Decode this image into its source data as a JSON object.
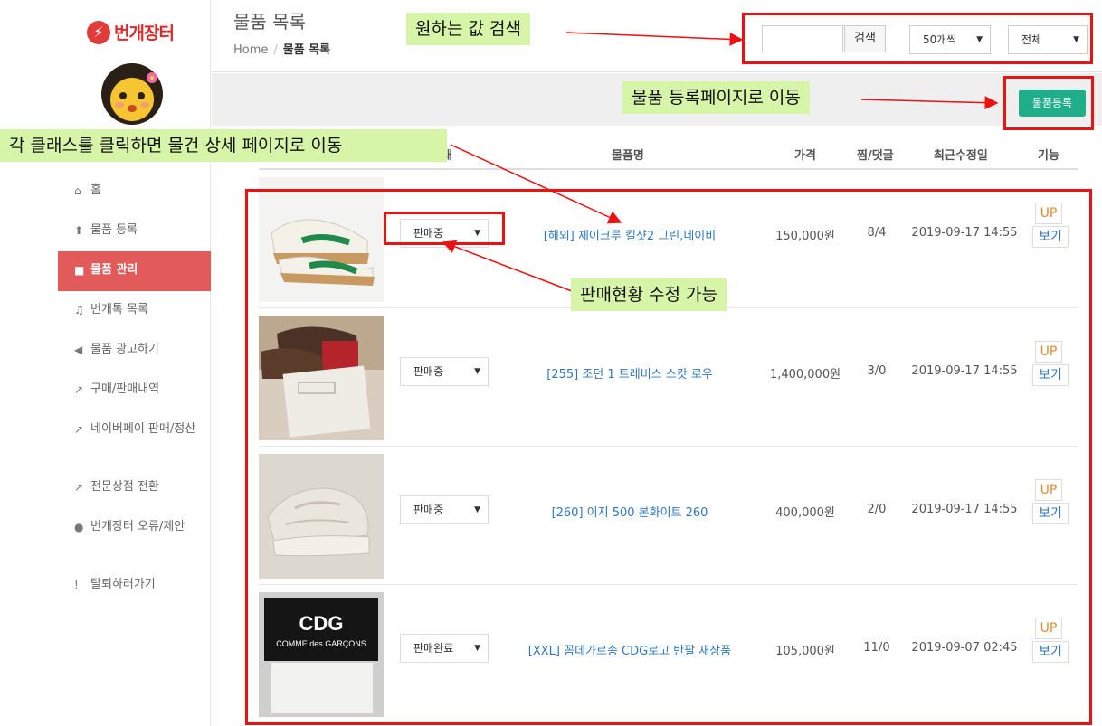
{
  "sidebar": {
    "logo_text": "번개장터",
    "logo_mark": "⚡",
    "items": [
      {
        "icon": "home-icon",
        "glyph": "⌂",
        "label": "홈"
      },
      {
        "icon": "upload-icon",
        "glyph": "⬆",
        "label": "물품 등록"
      },
      {
        "icon": "cube-icon",
        "glyph": "■",
        "label": "물품 관리"
      },
      {
        "icon": "bell-icon",
        "glyph": "♫",
        "label": "번개톡 목록"
      },
      {
        "icon": "megaphone-icon",
        "glyph": "◀",
        "label": "물품 광고하기"
      },
      {
        "icon": "external-link-icon",
        "glyph": "↗",
        "label": "구매/판매내역"
      },
      {
        "icon": "external-link-icon",
        "glyph": "↗",
        "label": "네이버페이 판매/정산"
      },
      {
        "icon": "external-link-icon",
        "glyph": "↗",
        "label": "전문상점 전환"
      },
      {
        "icon": "chat-icon",
        "glyph": "●",
        "label": "번개장터 오류/제안"
      },
      {
        "icon": "exclamation-icon",
        "glyph": "!",
        "label": "탈퇴하러가기"
      }
    ],
    "active_index": 2
  },
  "header": {
    "title": "물품 목록",
    "breadcrumb_home": "Home",
    "breadcrumb_sep": "/",
    "breadcrumb_current": "물품 목록",
    "search_value": "",
    "search_button": "검색",
    "count_select": "50개씩",
    "filter_select": "전체"
  },
  "actions": {
    "register_button": "물품등록"
  },
  "table": {
    "headers": {
      "status": "상태",
      "name": "물품명",
      "price": "가격",
      "likes": "찜/댓글",
      "date": "최근수정일",
      "func": "기능"
    },
    "rows": [
      {
        "status": "판매중",
        "name": "[해외] 제이크루 킬샷2 그린,네이비",
        "price": "150,000원",
        "likes": "8/4",
        "date": "2019-09-17 14:55",
        "up": "UP",
        "view": "보기"
      },
      {
        "status": "판매중",
        "name": "[255] 조던 1 트레비스 스캇 로우",
        "price": "1,400,000원",
        "likes": "3/0",
        "date": "2019-09-17 14:55",
        "up": "UP",
        "view": "보기"
      },
      {
        "status": "판매중",
        "name": "[260] 이지 500 본화이트 260",
        "price": "400,000원",
        "likes": "2/0",
        "date": "2019-09-17 14:55",
        "up": "UP",
        "view": "보기"
      },
      {
        "status": "판매완료",
        "name": "[XXL] 꼼데가르송 CDG로고 반팔 새상품",
        "price": "105,000원",
        "likes": "11/0",
        "date": "2019-09-07 02:45",
        "up": "UP",
        "view": "보기"
      }
    ]
  },
  "thumb4_text": {
    "brand": "CDG",
    "line": "COMME des GARÇONS"
  },
  "annotations": {
    "search": "원하는 값 검색",
    "register": "물품 등록페이지로 이동",
    "detail": "각 클래스를 클릭하면 물건 상세 페이지로 이동",
    "status": "판매현황 수정 가능"
  },
  "colors": {
    "accent": "#e35a5a",
    "register": "#1fad8a",
    "link": "#2e78c0",
    "annotation_red": "#ee1111",
    "note_bg": "#d7f5a8"
  }
}
